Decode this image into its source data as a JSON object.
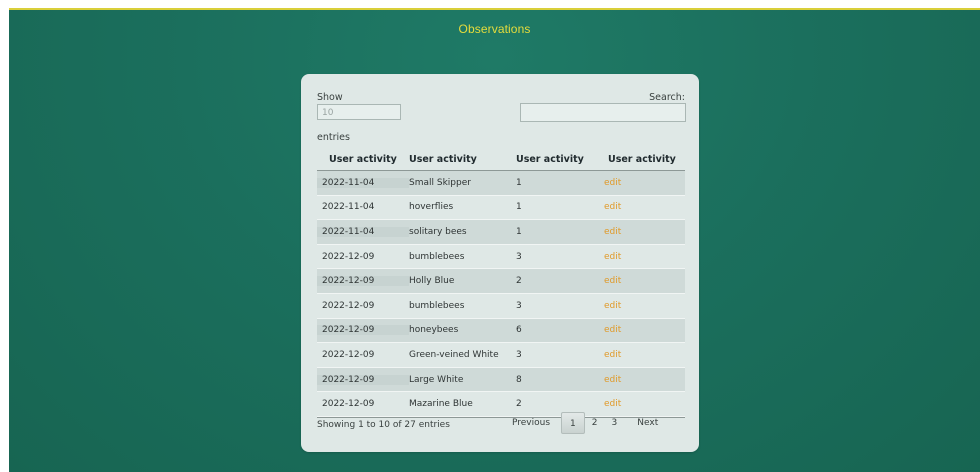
{
  "page": {
    "title": "Observations"
  },
  "controls": {
    "show_label": "Show",
    "show_value": "10",
    "entries_label": "entries",
    "search_label": "Search:",
    "search_value": ""
  },
  "table": {
    "headers": [
      "User activity",
      "User activity",
      "User activity",
      "User activity"
    ],
    "rows": [
      {
        "date": "2022-11-04",
        "species": "Small Skipper",
        "count": "1",
        "action": "edit"
      },
      {
        "date": "2022-11-04",
        "species": "hoverflies",
        "count": "1",
        "action": "edit"
      },
      {
        "date": "2022-11-04",
        "species": "solitary bees",
        "count": "1",
        "action": "edit"
      },
      {
        "date": "2022-12-09",
        "species": "bumblebees",
        "count": "3",
        "action": "edit"
      },
      {
        "date": "2022-12-09",
        "species": "Holly Blue",
        "count": "2",
        "action": "edit"
      },
      {
        "date": "2022-12-09",
        "species": "bumblebees",
        "count": "3",
        "action": "edit"
      },
      {
        "date": "2022-12-09",
        "species": "honeybees",
        "count": "6",
        "action": "edit"
      },
      {
        "date": "2022-12-09",
        "species": "Green-veined White",
        "count": "3",
        "action": "edit"
      },
      {
        "date": "2022-12-09",
        "species": "Large White",
        "count": "8",
        "action": "edit"
      },
      {
        "date": "2022-12-09",
        "species": "Mazarine Blue",
        "count": "2",
        "action": "edit"
      }
    ]
  },
  "footer": {
    "info": "Showing 1 to 10 of 27 entries",
    "pagination": {
      "previous": "Previous",
      "pages": [
        "1",
        "2",
        "3"
      ],
      "current": "1",
      "next": "Next"
    }
  },
  "colors": {
    "background": "#1b6f5d",
    "title": "#e6dc3b",
    "card": "#dfe8e6",
    "link": "#e09a2a"
  }
}
